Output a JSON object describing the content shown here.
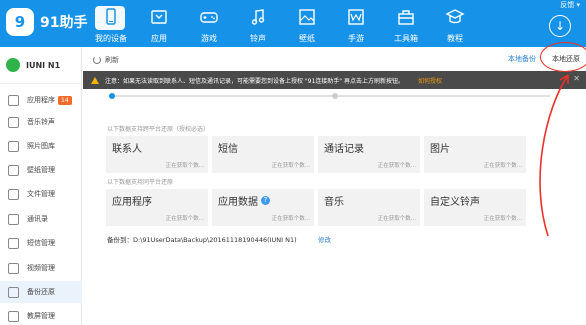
{
  "app": {
    "logo_badge": "9",
    "logo_text": "91助手",
    "window_controls": "反馈 ▾"
  },
  "nav": [
    {
      "label": "我的设备",
      "icon": "device-icon"
    },
    {
      "label": "应用",
      "icon": "app-icon"
    },
    {
      "label": "游戏",
      "icon": "game-icon"
    },
    {
      "label": "铃声",
      "icon": "ringtone-icon"
    },
    {
      "label": "壁纸",
      "icon": "wallpaper-icon"
    },
    {
      "label": "手游",
      "icon": "mobile-game-icon"
    },
    {
      "label": "工具箱",
      "icon": "toolbox-icon"
    },
    {
      "label": "教程",
      "icon": "tutorial-icon"
    }
  ],
  "device": {
    "name": "IUNI N1"
  },
  "sidebar": {
    "items": [
      {
        "label": "应用程序",
        "badge": "14"
      },
      {
        "label": "音乐铃声"
      },
      {
        "label": "照片图库"
      },
      {
        "label": "壁纸管理"
      },
      {
        "label": "文件管理"
      },
      {
        "label": "通讯录"
      },
      {
        "label": "短信管理"
      },
      {
        "label": "视频管理"
      },
      {
        "label": "备份还原"
      },
      {
        "label": "教屏管理"
      }
    ]
  },
  "toolbar": {
    "refresh_label": "刷新",
    "tab_backup": "本地备份",
    "tab_restore": "本地还原"
  },
  "notice": {
    "text": "注意：如果无法读取到联系人、短信及通讯记录，可能需要您到设备上授权 \"91连接助手\" 再点击上方刷新按钮。",
    "link": "如何授权",
    "close": "✕"
  },
  "colors": {
    "accent": "#1693e8",
    "active_dot": "#1693e8",
    "inactive_dot": "#cccccc",
    "warning": "#f5b300",
    "highlight_red": "#e8312a"
  },
  "sections": [
    {
      "label": "以下数据支持跨平台还原（授权必选）",
      "cells": [
        {
          "title": "联系人",
          "status": "正在获取个数..."
        },
        {
          "title": "短信",
          "status": "正在获取个数..."
        },
        {
          "title": "通话记录",
          "status": "正在获取个数..."
        },
        {
          "title": "图片",
          "status": "正在获取个数..."
        }
      ]
    },
    {
      "label": "以下数据支持同平台还原",
      "cells": [
        {
          "title": "应用程序",
          "status": "正在获取个数..."
        },
        {
          "title": "应用数据",
          "status": "正在获取个数...",
          "help_icon": "?"
        },
        {
          "title": "音乐",
          "status": "正在获取个数..."
        },
        {
          "title": "自定义铃声",
          "status": "正在获取个数..."
        }
      ]
    }
  ],
  "backup": {
    "path": "备份到：D:\\91UserData\\Backup\\20161118190446(IUNI N1)",
    "modify": "修改"
  }
}
